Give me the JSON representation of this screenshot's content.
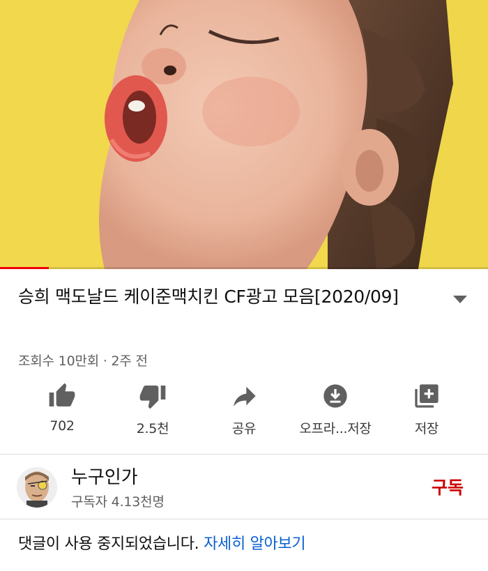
{
  "video": {
    "progress_fraction": 0.1,
    "colors": {
      "background": "#f2d94a",
      "progress": "#ee0000"
    }
  },
  "title": "승희 맥도날드 케이준맥치킨 CF광고 모음[2020/09]",
  "meta": "조회수 10만회 · 2주 전",
  "actions": [
    {
      "icon": "thumbs-up-icon",
      "label": "702"
    },
    {
      "icon": "thumbs-down-icon",
      "label": "2.5천"
    },
    {
      "icon": "share-icon",
      "label": "공유"
    },
    {
      "icon": "download-icon",
      "label": "오프라...저장"
    },
    {
      "icon": "add-to-playlist-icon",
      "label": "저장"
    }
  ],
  "channel": {
    "name": "누구인가",
    "subscribers": "구독자 4.13천명",
    "subscribe_label": "구독",
    "subscribe_color": "#cc0000"
  },
  "comments": {
    "notice": "댓글이 사용 중지되었습니다.",
    "learn_more": "자세히 알아보기",
    "link_color": "#065fd4"
  }
}
